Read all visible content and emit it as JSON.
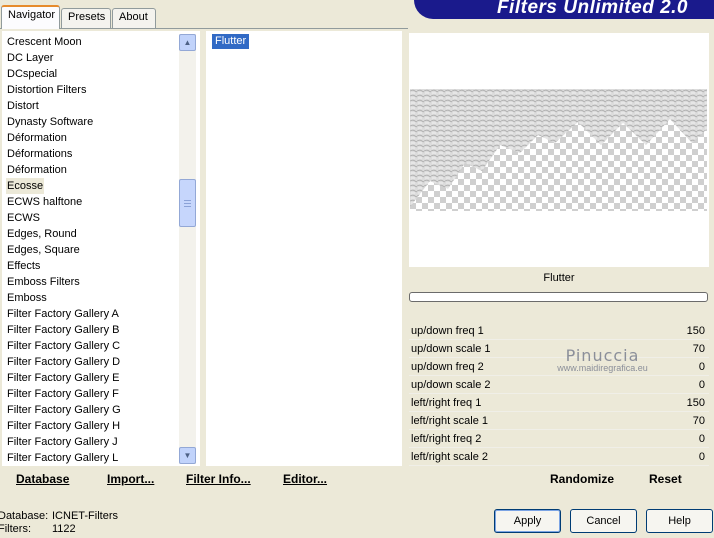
{
  "tabs": [
    "Navigator",
    "Presets",
    "About"
  ],
  "app_title": "Filters Unlimited 2.0",
  "categories": [
    "Crescent Moon",
    "DC Layer",
    "DCspecial",
    "Distortion Filters",
    "Distort",
    "Dynasty Software",
    "Déformation",
    "Déformations",
    "Déformation",
    "Ecosse",
    "ECWS halftone",
    "ECWS",
    "Edges, Round",
    "Edges, Square",
    "Effects",
    "Emboss Filters",
    "Emboss",
    "Filter Factory Gallery A",
    "Filter Factory Gallery B",
    "Filter Factory Gallery C",
    "Filter Factory Gallery D",
    "Filter Factory Gallery E",
    "Filter Factory Gallery F",
    "Filter Factory Gallery G",
    "Filter Factory Gallery H",
    "Filter Factory Gallery J",
    "Filter Factory Gallery L"
  ],
  "selected_category": "Ecosse",
  "filters": [
    "Flutter"
  ],
  "filter_name": "Flutter",
  "params": [
    {
      "label": "up/down freq 1",
      "value": "150"
    },
    {
      "label": "up/down scale 1",
      "value": "70"
    },
    {
      "label": "up/down freq 2",
      "value": "0"
    },
    {
      "label": "up/down scale 2",
      "value": "0"
    },
    {
      "label": "left/right freq 1",
      "value": "150"
    },
    {
      "label": "left/right scale 1",
      "value": "70"
    },
    {
      "label": "left/right freq 2",
      "value": "0"
    },
    {
      "label": "left/right scale 2",
      "value": "0"
    }
  ],
  "watermark": {
    "name": "Pinuccia",
    "url": "www.maidiregrafica.eu"
  },
  "links": {
    "database": "Database",
    "import": "Import...",
    "filter_info": "Filter Info...",
    "editor": "Editor...",
    "randomize": "Randomize",
    "reset": "Reset"
  },
  "status": {
    "database_label": "Database:",
    "database_value": "ICNET-Filters",
    "filters_label": "Filters:",
    "filters_value": "1122"
  },
  "buttons": {
    "apply": "Apply",
    "cancel": "Cancel",
    "help": "Help"
  },
  "colors": {
    "selection": "#316ac5",
    "banner": "#1a1a8c",
    "window_bg": "#ece9d8"
  }
}
